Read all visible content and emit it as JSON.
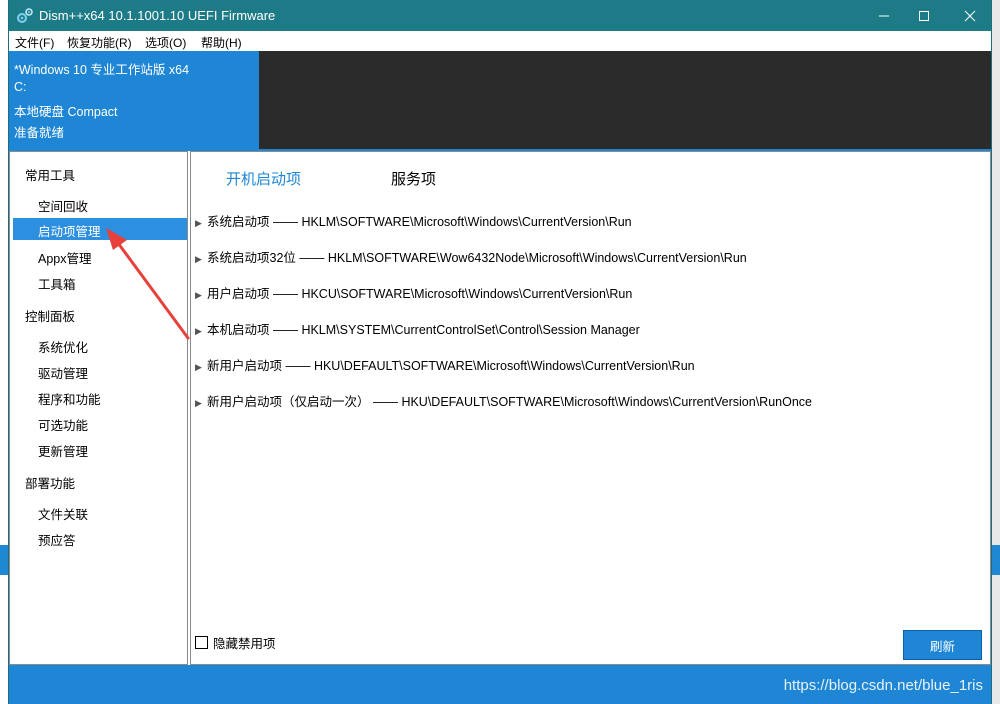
{
  "window": {
    "title": "Dism++x64 10.1.1001.10 UEFI Firmware"
  },
  "menu": [
    "文件(F)",
    "恢复功能(R)",
    "选项(O)",
    "帮助(H)"
  ],
  "info": {
    "os": "*Windows 10 专业工作站版 x64",
    "drive": "C:",
    "disk": "本地硬盘 Compact",
    "status": "准备就绪"
  },
  "sidebar": {
    "cat1": "常用工具",
    "items1": [
      "空间回收",
      "启动项管理",
      "Appx管理",
      "工具箱"
    ],
    "cat2": "控制面板",
    "items2": [
      "系统优化",
      "驱动管理",
      "程序和功能",
      "可选功能",
      "更新管理"
    ],
    "cat3": "部署功能",
    "items3": [
      "文件关联",
      "预应答"
    ]
  },
  "tabs": [
    "开机启动项",
    "服务项"
  ],
  "rows": [
    "系统启动项 —— HKLM\\SOFTWARE\\Microsoft\\Windows\\CurrentVersion\\Run",
    "系统启动项32位 —— HKLM\\SOFTWARE\\Wow6432Node\\Microsoft\\Windows\\CurrentVersion\\Run",
    "用户启动项 —— HKCU\\SOFTWARE\\Microsoft\\Windows\\CurrentVersion\\Run",
    "本机启动项 —— HKLM\\SYSTEM\\CurrentControlSet\\Control\\Session Manager",
    "新用户启动项 —— HKU\\DEFAULT\\SOFTWARE\\Microsoft\\Windows\\CurrentVersion\\Run",
    "新用户启动项（仅启动一次） —— HKU\\DEFAULT\\SOFTWARE\\Microsoft\\Windows\\CurrentVersion\\RunOnce"
  ],
  "hide_disabled": "隐藏禁用项",
  "refresh": "刷新",
  "watermark": "https://blog.csdn.net/blue_1ris",
  "icons": {
    "app": "gear-icon",
    "minimize": "minimize-icon",
    "maximize": "maximize-icon",
    "close": "close-icon",
    "expand": "chevron-right-icon",
    "annotation": "red-arrow"
  }
}
